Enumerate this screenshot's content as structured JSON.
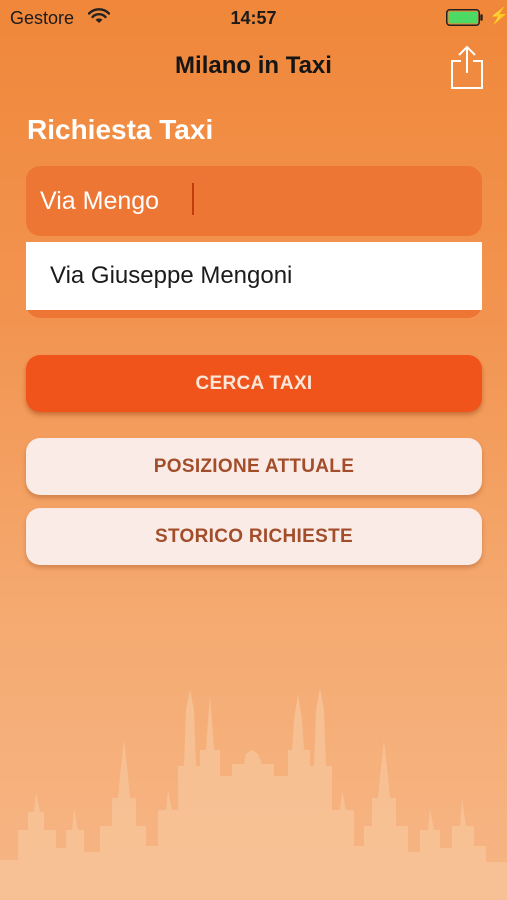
{
  "status_bar": {
    "carrier": "Gestore",
    "time": "14:57"
  },
  "nav": {
    "title": "Milano in Taxi"
  },
  "form": {
    "section_title": "Richiesta Taxi",
    "address_value": "Via Mengo",
    "suggestions": [
      "Via Giuseppe Mengoni"
    ]
  },
  "buttons": {
    "search": "CERCA TAXI",
    "current_position": "POSIZIONE ATTUALE",
    "request_history": "STORICO RICHIESTE"
  },
  "colors": {
    "background_top": "#F0873A",
    "background_bottom": "#F6B585",
    "field": "#ED7634",
    "primary_button": "#F0541B",
    "secondary_button": "#FBEBE7",
    "secondary_text": "#A24E2B",
    "battery": "#4CD964"
  },
  "icons": [
    "wifi-icon",
    "battery-icon",
    "charging-bolt-icon",
    "share-icon",
    "milan-duomo-skyline"
  ]
}
